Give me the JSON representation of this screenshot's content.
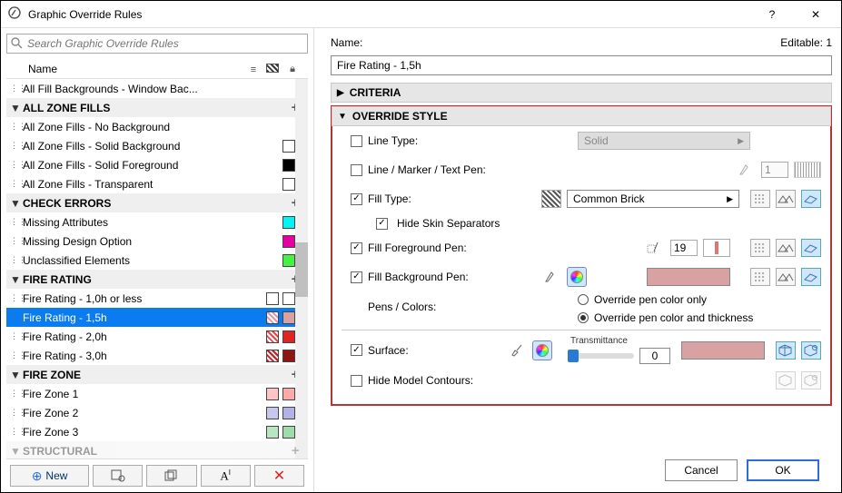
{
  "titlebar": {
    "title": "Graphic Override Rules",
    "help": "?",
    "close": "✕"
  },
  "left": {
    "search_placeholder": "Search Graphic Override Rules",
    "col_name": "Name",
    "groups": [
      {
        "type": "item",
        "label": "All Fill Backgrounds - Window Bac..."
      },
      {
        "type": "group",
        "label": "ALL ZONE FILLS"
      },
      {
        "type": "item",
        "label": "All Zone Fills - No Background"
      },
      {
        "type": "item",
        "label": "All Zone Fills - Solid Background",
        "sw": [
          "#ffffff"
        ]
      },
      {
        "type": "item",
        "label": "All Zone Fills - Solid Foreground",
        "sw": [
          "#000000"
        ]
      },
      {
        "type": "item",
        "label": "All Zone Fills - Transparent",
        "sw": [
          "#ffffff"
        ]
      },
      {
        "type": "group",
        "label": "CHECK ERRORS"
      },
      {
        "type": "item",
        "label": "Missing Attributes",
        "sw": [
          "#00f5f0"
        ]
      },
      {
        "type": "item",
        "label": "Missing Design Option",
        "sw": [
          "#e400a0"
        ]
      },
      {
        "type": "item",
        "label": "Unclassified Elements",
        "sw": [
          "#46f046"
        ]
      },
      {
        "type": "group",
        "label": "FIRE RATING"
      },
      {
        "type": "item",
        "label": "Fire Rating - 1,0h or less",
        "sw": [
          "#ffffff",
          "#ffffff"
        ]
      },
      {
        "type": "item",
        "label": "Fire Rating - 1,5h",
        "selected": true,
        "sw": [
          "hatch-pink",
          "#d8a2a2"
        ]
      },
      {
        "type": "item",
        "label": "Fire Rating - 2,0h",
        "sw": [
          "hatch-red",
          "#e02424"
        ]
      },
      {
        "type": "item",
        "label": "Fire Rating - 3,0h",
        "sw": [
          "hatch-red-d",
          "#8f1414"
        ]
      },
      {
        "type": "group",
        "label": "FIRE ZONE"
      },
      {
        "type": "item",
        "label": "Fire Zone 1",
        "sw": [
          "#ffc4c4",
          "#ffaaaa"
        ]
      },
      {
        "type": "item",
        "label": "Fire Zone 2",
        "sw": [
          "#c6c6f0",
          "#b2b2e6"
        ]
      },
      {
        "type": "item",
        "label": "Fire Zone 3",
        "sw": [
          "#b8e6c0",
          "#9edcae"
        ]
      },
      {
        "type": "group",
        "label": "STRUCTURAL",
        "cut": true
      }
    ],
    "buttons": {
      "new": "New"
    }
  },
  "right": {
    "name_label": "Name:",
    "editable": "Editable: 1",
    "name_value": "Fire Rating - 1,5h",
    "criteria": "CRITERIA",
    "override": "OVERRIDE STYLE",
    "line_type": "Line Type:",
    "line_type_val": "Solid",
    "line_pen": "Line / Marker / Text Pen:",
    "line_pen_val": "1",
    "fill_type": "Fill Type:",
    "fill_type_val": "Common Brick",
    "hide_skin": "Hide Skin Separators",
    "fill_fg": "Fill Foreground Pen:",
    "fill_fg_val": "19",
    "fill_bg": "Fill Background Pen:",
    "pens_colors": "Pens / Colors:",
    "opt1": "Override pen color only",
    "opt2": "Override pen color and thickness",
    "surface": "Surface:",
    "trans": "Transmittance",
    "trans_val": "0",
    "hide_model": "Hide Model Contours:"
  },
  "footer": {
    "cancel": "Cancel",
    "ok": "OK"
  }
}
